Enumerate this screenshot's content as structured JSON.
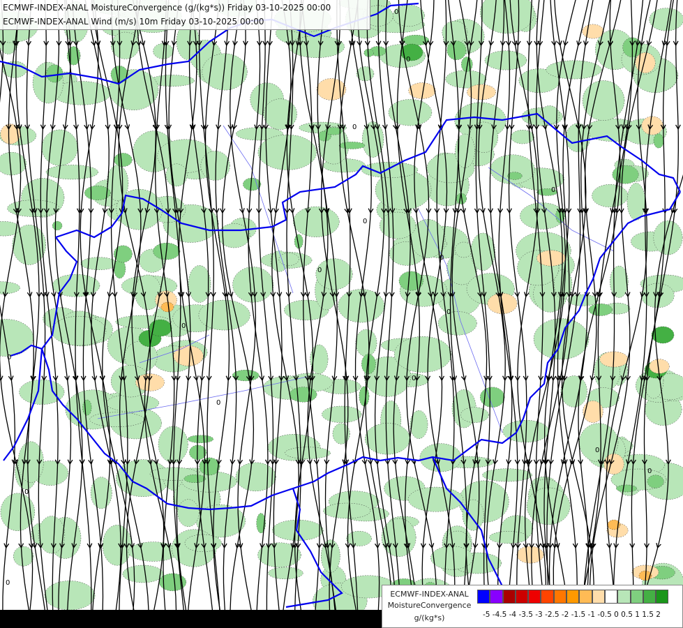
{
  "titles": {
    "line1": "ECMWF-INDEX-ANAL MoistureConvergence (g/(kg*s)) Friday 03-10-2025 00:00",
    "line2": "ECMWF-INDEX-ANAL Wind (m/s) 10m Friday 03-10-2025 00:00"
  },
  "legend": {
    "label_line1": "ECMWF-INDEX-ANAL",
    "label_line2": "MoistureConvergence",
    "label_line3": "g/(kg*s)",
    "ticks": "-5 -4.5 -4 -3.5 -3 -2.5 -2 -1.5 -1 -0.5 0  0.5  1  1.5  2",
    "colors": [
      "#0000ff",
      "#8800ff",
      "#aa0000",
      "#cc0000",
      "#ee0000",
      "#ff4400",
      "#ff7700",
      "#ff9900",
      "#ffbb55",
      "#ffddaa",
      "#ffffff",
      "#b8e6b8",
      "#7fcf7f",
      "#44b044",
      "#1a961a"
    ]
  },
  "map": {
    "field_colors": {
      "positive_light": "#b8e6b8",
      "positive_mid": "#7fcf7f",
      "positive_strong": "#44b044",
      "negative_light": "#ffddaa",
      "negative_mid": "#ffbb55",
      "border": "#0000ee",
      "streamline": "#000000"
    },
    "contour_label": "0"
  }
}
